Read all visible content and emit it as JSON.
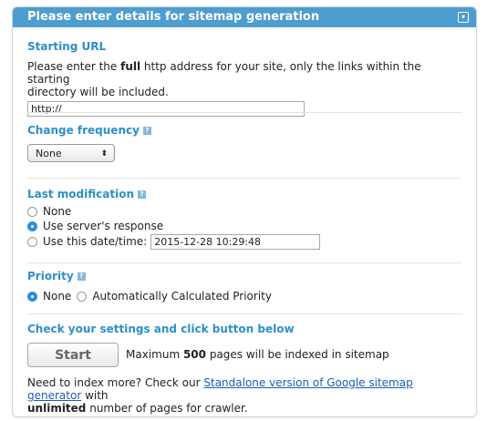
{
  "header": {
    "title": "Please enter details for sitemap generation",
    "collapse_glyph": "▾"
  },
  "starting_url": {
    "title": "Starting URL",
    "desc_before": "Please enter the ",
    "desc_bold": "full",
    "desc_after": " http address for your site, only the links within the starting",
    "desc_line2": "directory will be included.",
    "value": "http://"
  },
  "change_frequency": {
    "title": "Change frequency",
    "help": "?",
    "selected": "None",
    "arrows": "⬍"
  },
  "last_modification": {
    "title": "Last modification",
    "help": "?",
    "options": [
      "None",
      "Use server's response",
      "Use this date/time:"
    ],
    "selected_index": 1,
    "datetime": "2015-12-28 10:29:48"
  },
  "priority": {
    "title": "Priority",
    "help": "?",
    "options": [
      "None",
      "Automatically Calculated Priority"
    ],
    "selected_index": 0
  },
  "submit": {
    "title": "Check your settings and click button below",
    "button_label": "Start",
    "note_before": "Maximum ",
    "note_bold": "500",
    "note_after": " pages will be indexed in sitemap"
  },
  "footer": {
    "line1_before": "Need to index more? Check our ",
    "link_text": "Standalone version of Google sitemap generator",
    "line1_after": " with",
    "line2_bold": "unlimited",
    "line2_after": " number of pages for crawler."
  },
  "colors": {
    "header_bg": "#4d9dce",
    "section_title": "#2e8fc8",
    "link": "#1a5fb4"
  },
  "icons": {
    "help": "help-icon",
    "collapse": "collapse-icon",
    "select_arrows": "updown-arrows-icon"
  }
}
